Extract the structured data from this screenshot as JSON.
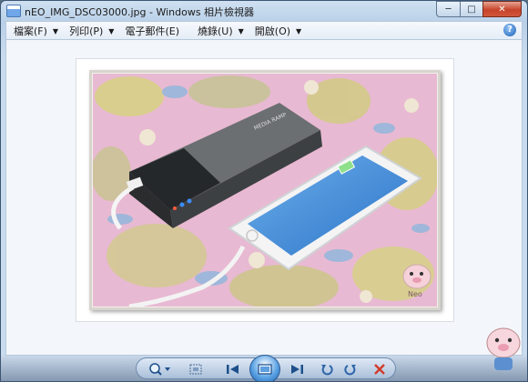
{
  "window": {
    "title": "nEO_IMG_DSC03000.jpg - Windows 相片檢視器",
    "minimize_label": "─",
    "maximize_label": "□",
    "close_label": "✕"
  },
  "menu": {
    "items": [
      {
        "label": "檔案(F)",
        "icon": "chevron-down-icon"
      },
      {
        "label": "列印(P)",
        "icon": "chevron-down-icon"
      },
      {
        "label": "電子郵件(E)",
        "icon": ""
      },
      {
        "label": "燒錄(U)",
        "icon": "chevron-down-icon"
      },
      {
        "label": "開啟(O)",
        "icon": "chevron-down-icon"
      }
    ],
    "help_label": "?"
  },
  "photo": {
    "powerbank_brand": "MEDIA RAMP",
    "watermark_text": "Neo"
  },
  "toolbar": {
    "buttons": [
      {
        "name": "zoom-icon"
      },
      {
        "name": "actual-size-icon"
      },
      {
        "name": "previous-icon"
      },
      {
        "name": "slideshow-icon"
      },
      {
        "name": "next-icon"
      },
      {
        "name": "rotate-left-icon"
      },
      {
        "name": "rotate-right-icon"
      },
      {
        "name": "delete-icon"
      }
    ]
  },
  "colors": {
    "accent": "#1c5fae",
    "close_button": "#c6442a",
    "delete": "#d23b2b"
  }
}
